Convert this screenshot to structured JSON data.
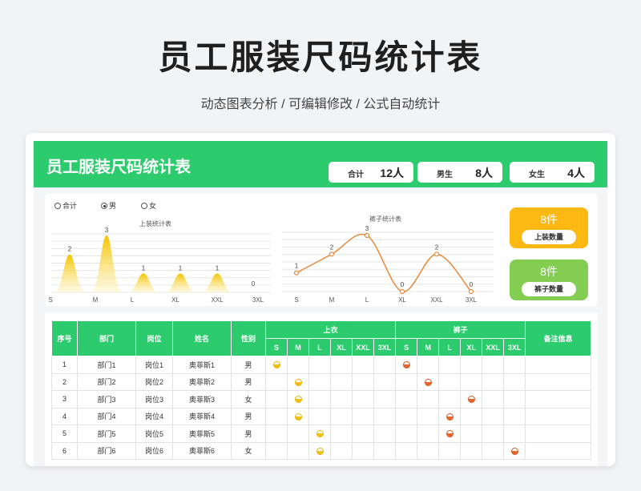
{
  "page": {
    "title": "员工服装尺码统计表",
    "subtitle": "动态图表分析 /  可编辑修改  /  公式自动统计"
  },
  "banner": {
    "title": "员工服装尺码统计表",
    "stats": [
      {
        "label": "合计",
        "value": "12人"
      },
      {
        "label": "男生",
        "value": "8人"
      },
      {
        "label": "女生",
        "value": "4人"
      }
    ]
  },
  "filter": {
    "options": [
      "合计",
      "男",
      "女"
    ],
    "selected": "男"
  },
  "kpis": [
    {
      "value": "8件",
      "label": "上装数量",
      "color": "#fdb912"
    },
    {
      "value": "8件",
      "label": "裤子数量",
      "color": "#83cd52"
    }
  ],
  "chart_data": [
    {
      "type": "area",
      "title": "上装统计表",
      "categories": [
        "S",
        "M",
        "L",
        "XL",
        "XXL",
        "3XL"
      ],
      "values": [
        2,
        3,
        1,
        1,
        1,
        0
      ],
      "ylim": [
        0,
        3
      ],
      "color": "#f5c400",
      "grid": true
    },
    {
      "type": "line",
      "title": "裤子统计表",
      "categories": [
        "S",
        "M",
        "L",
        "XL",
        "XXL",
        "3XL"
      ],
      "values": [
        1,
        2,
        3,
        0,
        2,
        0
      ],
      "ylim": [
        0,
        3
      ],
      "color": "#e8893a",
      "grid": true
    }
  ],
  "table": {
    "headers": {
      "no": "序号",
      "dept": "部门",
      "post": "岗位",
      "name": "姓名",
      "gender": "性别",
      "top": "上衣",
      "pants": "裤子",
      "notes": "备注信息"
    },
    "sizes": [
      "S",
      "M",
      "L",
      "XL",
      "XXL",
      "3XL"
    ],
    "rows": [
      {
        "no": "1",
        "dept": "部门1",
        "post": "岗位1",
        "name": "奥菲斯1",
        "gender": "男",
        "top": "S",
        "pants": "S"
      },
      {
        "no": "2",
        "dept": "部门2",
        "post": "岗位2",
        "name": "奥菲斯2",
        "gender": "男",
        "top": "M",
        "pants": "M"
      },
      {
        "no": "3",
        "dept": "部门3",
        "post": "岗位3",
        "name": "奥菲斯3",
        "gender": "女",
        "top": "M",
        "pants": "XL"
      },
      {
        "no": "4",
        "dept": "部门4",
        "post": "岗位4",
        "name": "奥菲斯4",
        "gender": "男",
        "top": "M",
        "pants": "L"
      },
      {
        "no": "5",
        "dept": "部门5",
        "post": "岗位5",
        "name": "奥菲斯5",
        "gender": "男",
        "top": "L",
        "pants": "L"
      },
      {
        "no": "6",
        "dept": "部门6",
        "post": "岗位6",
        "name": "奥菲斯6",
        "gender": "女",
        "top": "L",
        "pants": "3XL"
      }
    ]
  }
}
